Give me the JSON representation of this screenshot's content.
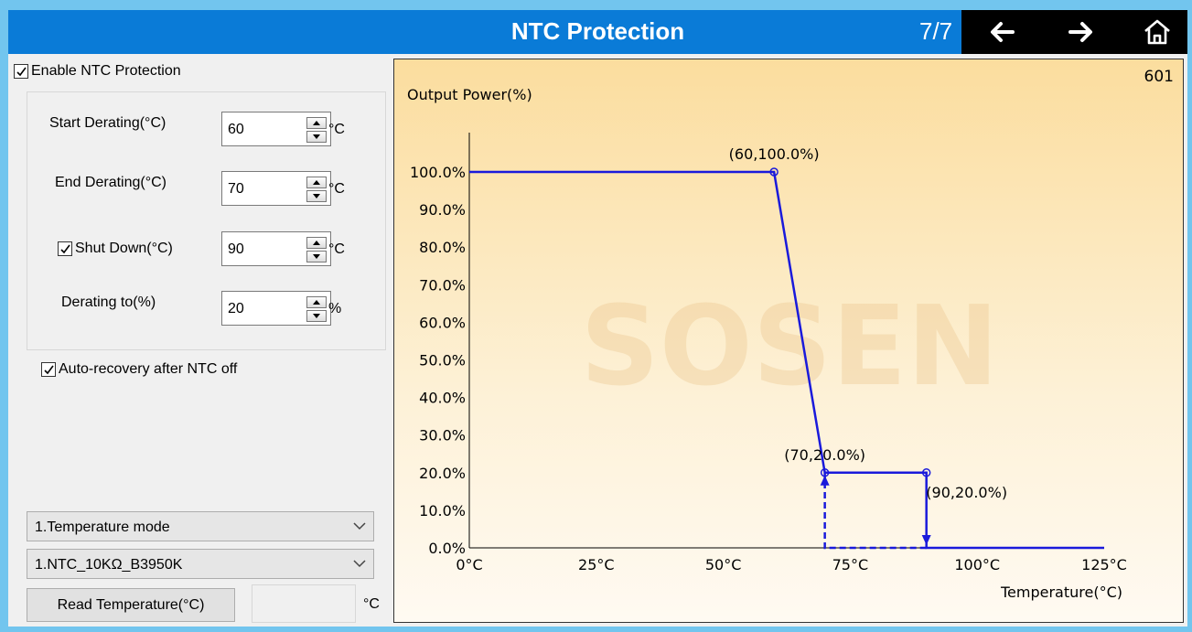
{
  "window": {
    "title": "NTC Protection",
    "pager": "7/7",
    "nav": {
      "back_icon": "arrow-left-icon",
      "forward_icon": "arrow-right-icon",
      "home_icon": "home-icon"
    },
    "colors": {
      "titlebar": "#0a7bd7",
      "navblock": "#000000",
      "border": "#72c5ee",
      "curve": "#1a1adb"
    }
  },
  "settings": {
    "enable_label": "Enable NTC Protection",
    "enable_checked": true,
    "start_derating": {
      "label": "Start Derating(°C)",
      "value": "60",
      "unit": "°C"
    },
    "end_derating": {
      "label": "End Derating(°C)",
      "value": "70",
      "unit": "°C"
    },
    "shutdown": {
      "label": "Shut Down(°C)",
      "value": "90",
      "unit": "°C",
      "checked": true
    },
    "derating_to": {
      "label": "Derating to(%)",
      "value": "20",
      "unit": "%"
    },
    "auto_recovery_label": "Auto-recovery after NTC off",
    "auto_recovery_checked": true
  },
  "controls": {
    "mode_select": "1.Temperature mode",
    "ntc_select": "1.NTC_10KΩ_B3950K",
    "read_button": "Read Temperature(°C)",
    "read_value": "",
    "read_unit": "°C"
  },
  "chart_data": {
    "type": "line",
    "id_label": "601",
    "watermark": "SOSEN",
    "ylabel": "Output Power(%)",
    "xlabel": "Temperature(°C)",
    "xlim": [
      0,
      125
    ],
    "ylim": [
      0,
      100
    ],
    "x_ticks": [
      "0°C",
      "25°C",
      "50°C",
      "75°C",
      "100°C",
      "125°C"
    ],
    "x_tick_values": [
      0,
      25,
      50,
      75,
      100,
      125
    ],
    "y_ticks": [
      "0.0%",
      "10.0%",
      "20.0%",
      "30.0%",
      "40.0%",
      "50.0%",
      "60.0%",
      "70.0%",
      "80.0%",
      "90.0%",
      "100.0%"
    ],
    "y_tick_values": [
      0,
      10,
      20,
      30,
      40,
      50,
      60,
      70,
      80,
      90,
      100
    ],
    "series": [
      {
        "x": [
          0,
          60,
          70,
          90,
          90,
          125
        ],
        "y": [
          100,
          100,
          20,
          20,
          0,
          0
        ]
      }
    ],
    "recovery_path": {
      "x": [
        90,
        70,
        70
      ],
      "y": [
        0,
        0,
        20
      ]
    },
    "points": [
      {
        "x": 60,
        "y": 100,
        "label": "(60,100.0%)"
      },
      {
        "x": 70,
        "y": 20,
        "label": "(70,20.0%)"
      },
      {
        "x": 90,
        "y": 20,
        "label": "(90,20.0%)"
      }
    ]
  }
}
